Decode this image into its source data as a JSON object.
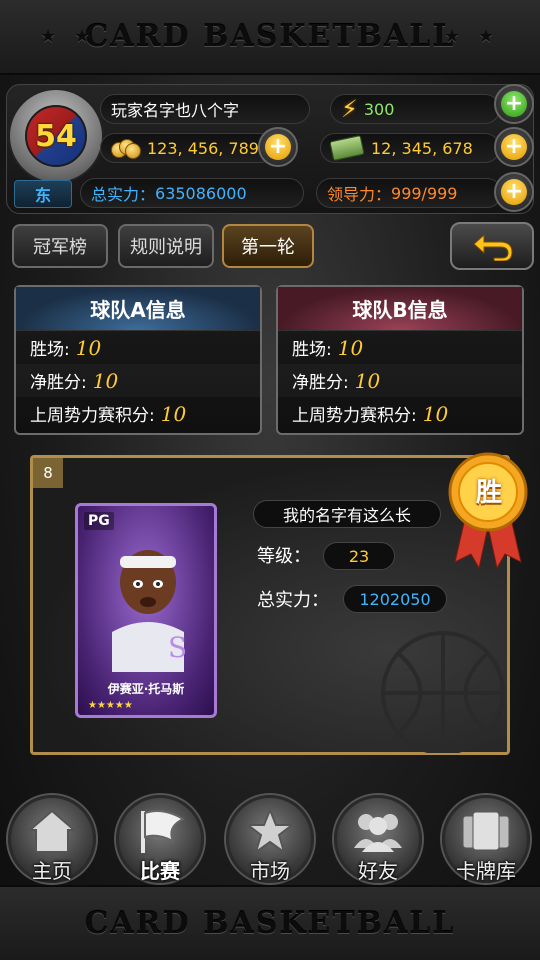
{
  "banner": {
    "title": "CARD BASKETBALL",
    "stars": "★ ★"
  },
  "player": {
    "level": "54",
    "name": "玩家名字也八个字",
    "region": "东",
    "energy": "300",
    "gold": "123, 456, 789",
    "cash": "12, 345, 678",
    "power_label": "总实力：",
    "power_value": "635086000",
    "leadership_label": "领导力：",
    "leadership_value": "999/999"
  },
  "tabs": [
    {
      "label": "冠军榜"
    },
    {
      "label": "规则说明"
    },
    {
      "label": "第一轮"
    }
  ],
  "teams": {
    "a": {
      "title": "球队A信息",
      "rows": [
        {
          "label": "胜场:",
          "value": "10"
        },
        {
          "label": "净胜分:",
          "value": "10"
        },
        {
          "label": "上周势力赛积分:",
          "value": "10"
        }
      ]
    },
    "b": {
      "title": "球队B信息",
      "rows": [
        {
          "label": "胜场:",
          "value": "10"
        },
        {
          "label": "净胜分:",
          "value": "10"
        },
        {
          "label": "上周势力赛积分:",
          "value": "10"
        }
      ]
    }
  },
  "match": {
    "number": "8",
    "card_position": "PG",
    "card_player": "伊赛亚·托马斯",
    "card_stars": "★★★★★",
    "opponent_name": "我的名字有这么长",
    "level_label": "等级：",
    "level_value": "23",
    "power_label": "总实力：",
    "power_value": "1202050",
    "result": "胜"
  },
  "nav": [
    {
      "label": "主页",
      "icon": "home-icon"
    },
    {
      "label": "比赛",
      "icon": "flag-icon"
    },
    {
      "label": "市场",
      "icon": "star-icon"
    },
    {
      "label": "好友",
      "icon": "friends-icon"
    },
    {
      "label": "卡牌库",
      "icon": "cards-icon"
    }
  ],
  "colors": {
    "accent_gold": "#ffcc33",
    "accent_blue": "#3fb4ff",
    "accent_orange": "#ff8a2a",
    "energy_green": "#8fe86a"
  }
}
